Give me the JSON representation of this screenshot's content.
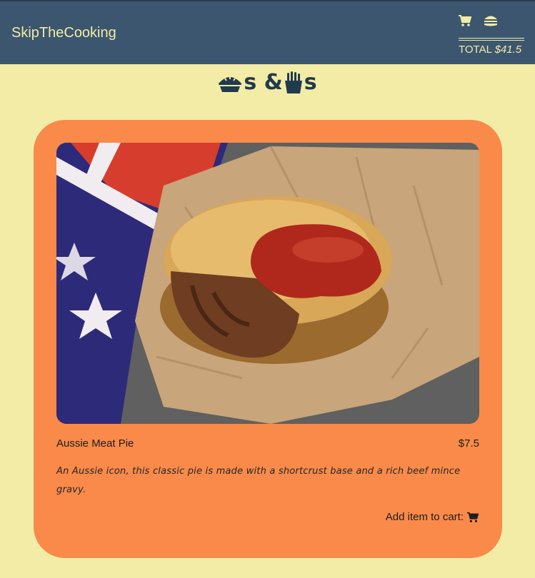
{
  "header": {
    "brand": "SkipTheCooking",
    "cart_icon": "cart-icon",
    "menu_icon": "burger-icon",
    "total_label": "TOTAL",
    "total_amount": "$41.5"
  },
  "section": {
    "title_separator": "s & ",
    "title_suffix": "s",
    "icons": [
      "pie-icon",
      "fries-icon"
    ]
  },
  "item": {
    "name": "Aussie Meat Pie",
    "price": "$7.5",
    "description": "An Aussie icon, this classic pie is made with a shortcrust base and a rich beef mince gravy.",
    "add_label": "Add item to cart:"
  },
  "colors": {
    "header_bg": "#3c566f",
    "page_bg": "#f2eca6",
    "card_bg": "#f98a4a",
    "title_color": "#213a4e"
  }
}
